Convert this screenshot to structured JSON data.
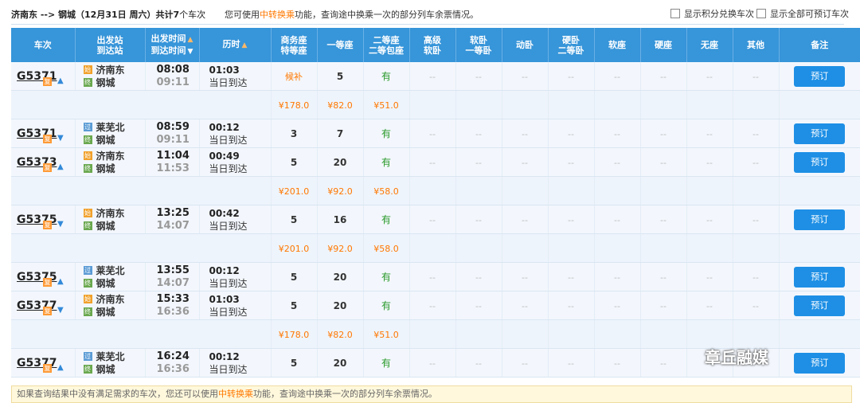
{
  "header": {
    "route": "济南东 --> 钢城（12月31日 周六）共计",
    "count": "7",
    "route_suffix": "个车次",
    "hint_pre": "您可使用",
    "hint_link": "中转换乘",
    "hint_post": "功能，查询途中换乘一次的部分列车余票情况。",
    "opt1": "显示积分兑换车次",
    "opt2": "显示全部可预订车次"
  },
  "columns": {
    "train": "车次",
    "station_1": "出发站",
    "station_2": "到达站",
    "time_1": "出发时间",
    "time_2": "到达时间",
    "duration": "历时",
    "biz_1": "商务座",
    "biz_2": "特等座",
    "first": "一等座",
    "second_1": "二等座",
    "second_2": "二等包座",
    "gaoji_1": "高级",
    "gaoji_2": "软卧",
    "ruanwo_1": "软卧",
    "ruanwo_2": "一等卧",
    "dongwo": "动卧",
    "yingwo_1": "硬卧",
    "yingwo_2": "二等卧",
    "ruanzuo": "软座",
    "yingzuo": "硬座",
    "wuzuo": "无座",
    "other": "其他",
    "remark": "备注"
  },
  "trains": [
    {
      "no": "G5371",
      "fu": "复",
      "from": "济南东",
      "to": "钢城",
      "dep": "08:08",
      "arr": "09:11",
      "dur": "01:03",
      "day": "当日到达",
      "biz": "候补",
      "first": "5",
      "second": "有",
      "book": "预订",
      "price": {
        "biz": "¥178.0",
        "first": "¥82.0",
        "second": "¥51.0"
      }
    },
    {
      "no": "G5371",
      "fu": "复",
      "from": "莱芜北",
      "to": "钢城",
      "dep": "08:59",
      "arr": "09:11",
      "dur": "00:12",
      "day": "当日到达",
      "biz": "3",
      "first": "7",
      "second": "有",
      "book": "预订"
    },
    {
      "no": "G5373",
      "fu": "复",
      "from": "济南东",
      "to": "钢城",
      "dep": "11:04",
      "arr": "11:53",
      "dur": "00:49",
      "day": "当日到达",
      "biz": "5",
      "first": "20",
      "second": "有",
      "book": "预订",
      "price": {
        "biz": "¥201.0",
        "first": "¥92.0",
        "second": "¥58.0"
      }
    },
    {
      "no": "G5375",
      "fu": "复",
      "from": "济南东",
      "to": "钢城",
      "dep": "13:25",
      "arr": "14:07",
      "dur": "00:42",
      "day": "当日到达",
      "biz": "5",
      "first": "16",
      "second": "有",
      "book": "预订",
      "price": {
        "biz": "¥201.0",
        "first": "¥92.0",
        "second": "¥58.0"
      }
    },
    {
      "no": "G5375",
      "fu": "复",
      "from": "莱芜北",
      "to": "钢城",
      "dep": "13:55",
      "arr": "14:07",
      "dur": "00:12",
      "day": "当日到达",
      "biz": "5",
      "first": "20",
      "second": "有",
      "book": "预订"
    },
    {
      "no": "G5377",
      "fu": "复",
      "from": "济南东",
      "to": "钢城",
      "dep": "15:33",
      "arr": "16:36",
      "dur": "01:03",
      "day": "当日到达",
      "biz": "5",
      "first": "20",
      "second": "有",
      "book": "预订",
      "price": {
        "biz": "¥178.0",
        "first": "¥82.0",
        "second": "¥51.0"
      }
    },
    {
      "no": "G5377",
      "fu": "复",
      "from": "莱芜北",
      "to": "钢城",
      "dep": "16:24",
      "arr": "16:36",
      "dur": "00:12",
      "day": "当日到达",
      "biz": "5",
      "first": "20",
      "second": "有",
      "book": "预订"
    }
  ],
  "dash": "--",
  "footer": {
    "pre": "如果查询结果中没有满足需求的车次，您还可以使用",
    "link": "中转换乘",
    "post": "功能，查询途中换乘一次的部分列车余票情况。"
  },
  "watermark": "章丘融媒"
}
